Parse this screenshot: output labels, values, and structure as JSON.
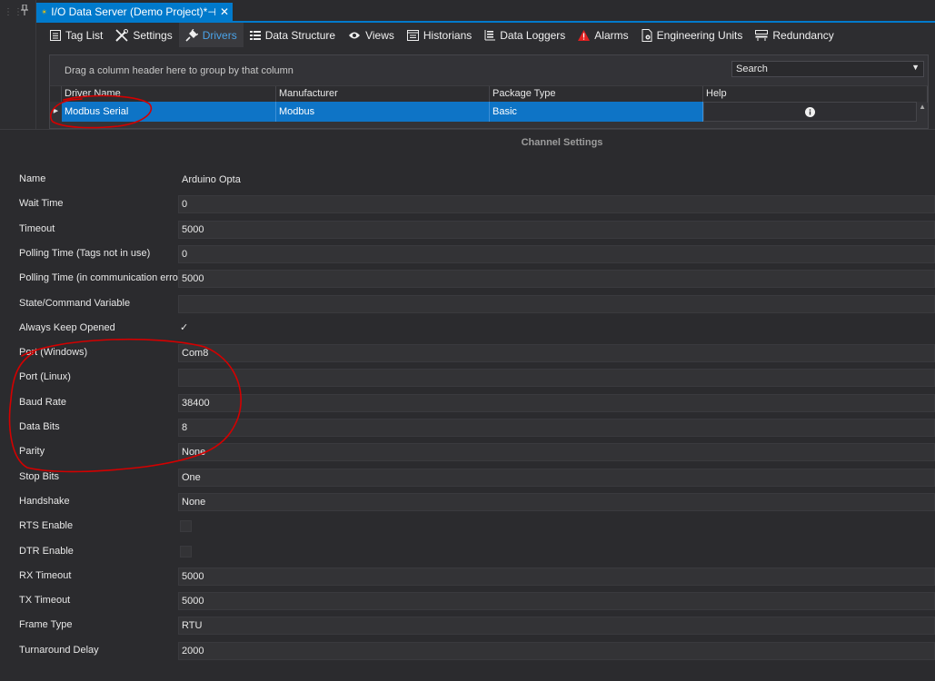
{
  "doc_tab": {
    "title": "I/O Data Server (Demo Project)*",
    "pin": "⊣",
    "close": "✕"
  },
  "toolbar": [
    {
      "label": "Tag List",
      "icon": "tag-list-icon"
    },
    {
      "label": "Settings",
      "icon": "settings-tools-icon"
    },
    {
      "label": "Drivers",
      "icon": "plug-icon",
      "active": true
    },
    {
      "label": "Data Structure",
      "icon": "data-structure-icon"
    },
    {
      "label": "Views",
      "icon": "eye-icon"
    },
    {
      "label": "Historians",
      "icon": "historian-icon"
    },
    {
      "label": "Data Loggers",
      "icon": "data-logger-icon"
    },
    {
      "label": "Alarms",
      "icon": "alarm-icon"
    },
    {
      "label": "Engineering Units",
      "icon": "engineering-units-icon"
    },
    {
      "label": "Redundancy",
      "icon": "redundancy-icon"
    }
  ],
  "grid": {
    "group_hint": "Drag a column header here to group by that column",
    "search_label": "Search",
    "columns": [
      "Driver Name",
      "Manufacturer",
      "Package Type",
      "Help"
    ],
    "rows": [
      {
        "driver_name": "Modbus Serial",
        "manufacturer": "Modbus",
        "package_type": "Basic",
        "help": "info-icon"
      }
    ]
  },
  "channel_settings": {
    "title": "Channel Settings",
    "properties": [
      {
        "label": "Name",
        "value": "Arduino Opta",
        "type": "text"
      },
      {
        "label": "Wait Time",
        "value": "0",
        "type": "text"
      },
      {
        "label": "Timeout",
        "value": "5000",
        "type": "text"
      },
      {
        "label": "Polling Time (Tags not in use)",
        "value": "0",
        "type": "text"
      },
      {
        "label": "Polling Time (in communication error)",
        "value": "5000",
        "type": "text"
      },
      {
        "label": "State/Command Variable",
        "value": "",
        "type": "text"
      },
      {
        "label": "Always Keep Opened",
        "checked": true,
        "type": "checkbox"
      },
      {
        "label": "Port (Windows)",
        "value": "Com8",
        "type": "text"
      },
      {
        "label": "Port (Linux)",
        "value": "",
        "type": "text"
      },
      {
        "label": "Baud Rate",
        "value": "38400",
        "type": "text"
      },
      {
        "label": "Data Bits",
        "value": "8",
        "type": "text"
      },
      {
        "label": "Parity",
        "value": "None",
        "type": "text"
      },
      {
        "label": "Stop Bits",
        "value": "One",
        "type": "text"
      },
      {
        "label": "Handshake",
        "value": "None",
        "type": "text"
      },
      {
        "label": "RTS Enable",
        "checked": false,
        "type": "checkbox"
      },
      {
        "label": "DTR Enable",
        "checked": false,
        "type": "checkbox"
      },
      {
        "label": "RX Timeout",
        "value": "5000",
        "type": "text"
      },
      {
        "label": "TX Timeout",
        "value": "5000",
        "type": "text"
      },
      {
        "label": "Frame Type",
        "value": "RTU",
        "type": "text"
      },
      {
        "label": "Turnaround Delay",
        "value": "2000",
        "type": "text"
      }
    ]
  },
  "colors": {
    "accent": "#007acc",
    "selection": "#0e74c6",
    "background": "#2b2b2e",
    "annotation": "#d40000"
  }
}
